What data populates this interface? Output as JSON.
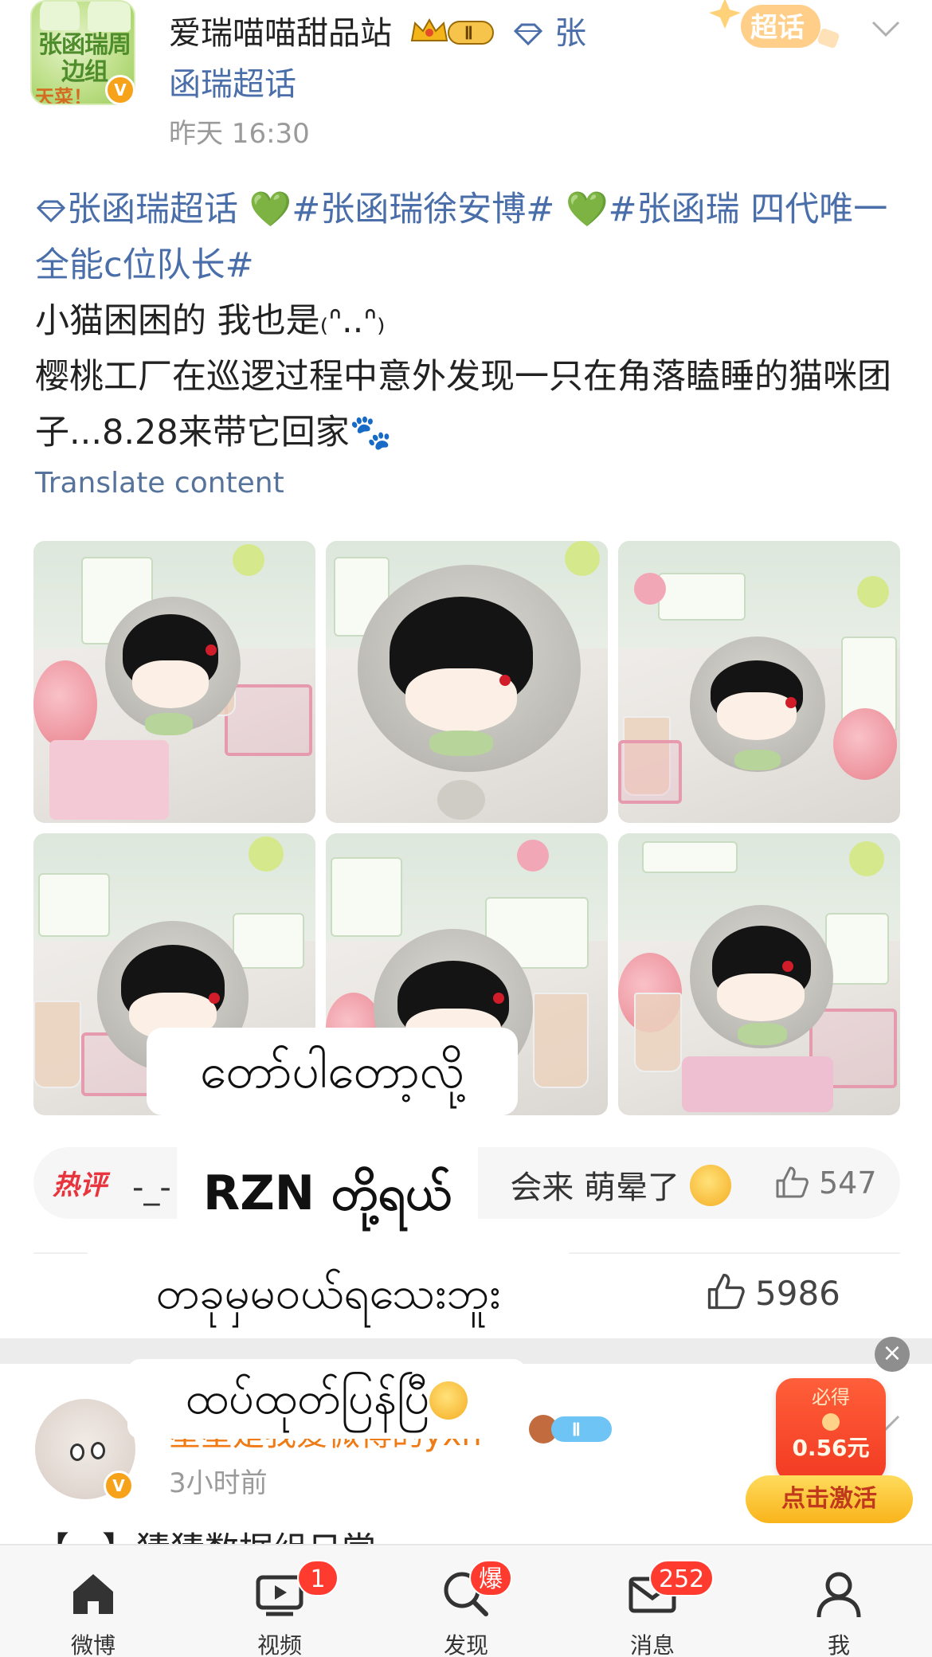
{
  "post": {
    "avatar_text": "张函瑞周边组",
    "avatar_tag": "天菜！",
    "username": "爱瑞喵喵甜品站",
    "level_badge": "Ⅱ",
    "topic": "张函瑞超话",
    "timestamp": "昨天 16:30",
    "super_badge": "超话",
    "body": {
      "link_topic": "张函瑞超话",
      "heart1": "💚",
      "link_hashtag1": "#张函瑞徐安博#",
      "heart2": "💚",
      "link_hashtag2": "#张函瑞 四代唯一全能c位队长#",
      "line1": "小猫困困的 我也是",
      "line1_kaomoji": "₍ᐢ..ᐢ₎",
      "line2": "樱桃工厂在巡逻过程中意外发现一只在角落瞌睡的猫咪团子...8.28来带它回家",
      "paw": "🐾"
    },
    "translate_label": "Translate content"
  },
  "hot_comment": {
    "tag": "热评",
    "text_prefix": "-_-",
    "text_suffix": "会来 萌晕了",
    "likes": "547"
  },
  "action": {
    "likes": "5986"
  },
  "subtitles": {
    "line1": "တော်ပါတော့လို့",
    "line2": "RZN တို့ရယ်",
    "line3": "တခုမှမဝယ်ရသေးဘူး",
    "line4": "ထပ်ထုတ်ပြန်ပြီ"
  },
  "post2": {
    "username": "星星是我爱微博的yxh",
    "timestamp": "3小时前",
    "text_preview": "【...】猜猜数据组日常"
  },
  "redpacket": {
    "must_label": "必得",
    "amount": "0.56元",
    "activate_label": "点击激活"
  },
  "tabbar": {
    "tabs": [
      {
        "label": "微博",
        "icon": "home-icon"
      },
      {
        "label": "视频",
        "icon": "video-icon",
        "badge": "1"
      },
      {
        "label": "发现",
        "icon": "discover-icon",
        "badge": "爆"
      },
      {
        "label": "消息",
        "icon": "message-icon",
        "badge": "252"
      },
      {
        "label": "我",
        "icon": "profile-icon"
      }
    ]
  },
  "colors": {
    "link": "#4a6ea9",
    "hot_red": "#e8343d",
    "badge_red": "#ff3b30",
    "vip_orange": "#f6a21a"
  }
}
